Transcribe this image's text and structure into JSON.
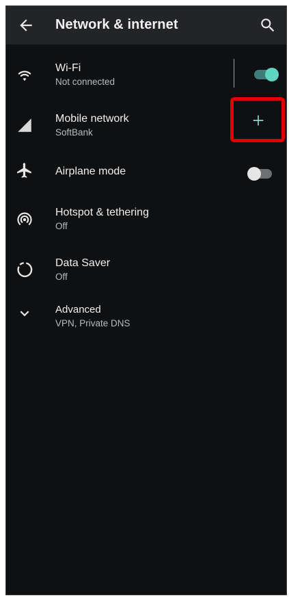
{
  "appbar": {
    "title": "Network & internet",
    "back_icon": "arrow-back-icon",
    "search_icon": "search-icon"
  },
  "items": [
    {
      "icon": "wifi-icon",
      "label": "Wi-Fi",
      "sublabel": "Not connected",
      "control": "toggle",
      "toggle_on": true
    },
    {
      "icon": "signal-icon",
      "label": "Mobile network",
      "sublabel": "SoftBank",
      "control": "add",
      "control_icon": "plus-icon"
    },
    {
      "icon": "airplane-icon",
      "label": "Airplane mode",
      "sublabel": "",
      "control": "toggle",
      "toggle_on": false
    },
    {
      "icon": "hotspot-icon",
      "label": "Hotspot & tethering",
      "sublabel": "Off"
    },
    {
      "icon": "data-saver-icon",
      "label": "Data Saver",
      "sublabel": "Off"
    },
    {
      "icon": "chevron-down-icon",
      "label": "Advanced",
      "sublabel": "VPN, Private DNS"
    }
  ],
  "colors": {
    "background": "#0f1012",
    "appbar": "#232427",
    "accent": "#5fd4c3",
    "highlight": "#e30000"
  }
}
